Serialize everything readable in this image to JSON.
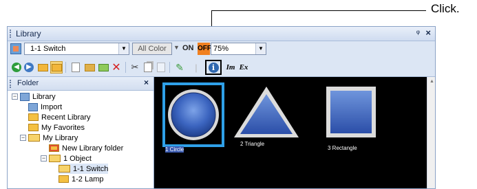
{
  "callout": {
    "text": "Click."
  },
  "window": {
    "title": "Library",
    "pin_glyph": "⊣",
    "close_glyph": "×"
  },
  "selector": {
    "library_value": "1-1 Switch",
    "color_value": "All Color",
    "on_label": "ON",
    "off_label": "OFF",
    "zoom_value": "75%"
  },
  "toolbar": {
    "icons": [
      "back-icon",
      "forward-icon",
      "folder-up-icon",
      "folder-view-icon",
      "new-icon",
      "import-icon",
      "add-icon",
      "delete-icon",
      "cut-icon",
      "copy-icon",
      "paste-icon",
      "edit-icon",
      "info-icon",
      "import-text-icon",
      "export-text-icon"
    ],
    "import_text_label": "Im",
    "export_text_label": "Ex"
  },
  "folder_pane": {
    "title": "Folder",
    "close_glyph": "×",
    "tree": [
      {
        "label": "Library"
      },
      {
        "label": "Import"
      },
      {
        "label": "Recent Library"
      },
      {
        "label": "My Favorites"
      },
      {
        "label": "My Library"
      },
      {
        "label": "New Library folder"
      },
      {
        "label": "1 Object"
      },
      {
        "label": "1-1 Switch"
      },
      {
        "label": "1-2 Lamp"
      }
    ]
  },
  "items": [
    {
      "label": "1 Circle",
      "selected": true
    },
    {
      "label": "2 Triangle",
      "selected": false
    },
    {
      "label": "3 Rectangle",
      "selected": false
    }
  ],
  "colors": {
    "accent": "#3f9ee0",
    "shape_blue": "#3a66c0",
    "canvas": "#000000",
    "off_orange": "#f08020"
  }
}
